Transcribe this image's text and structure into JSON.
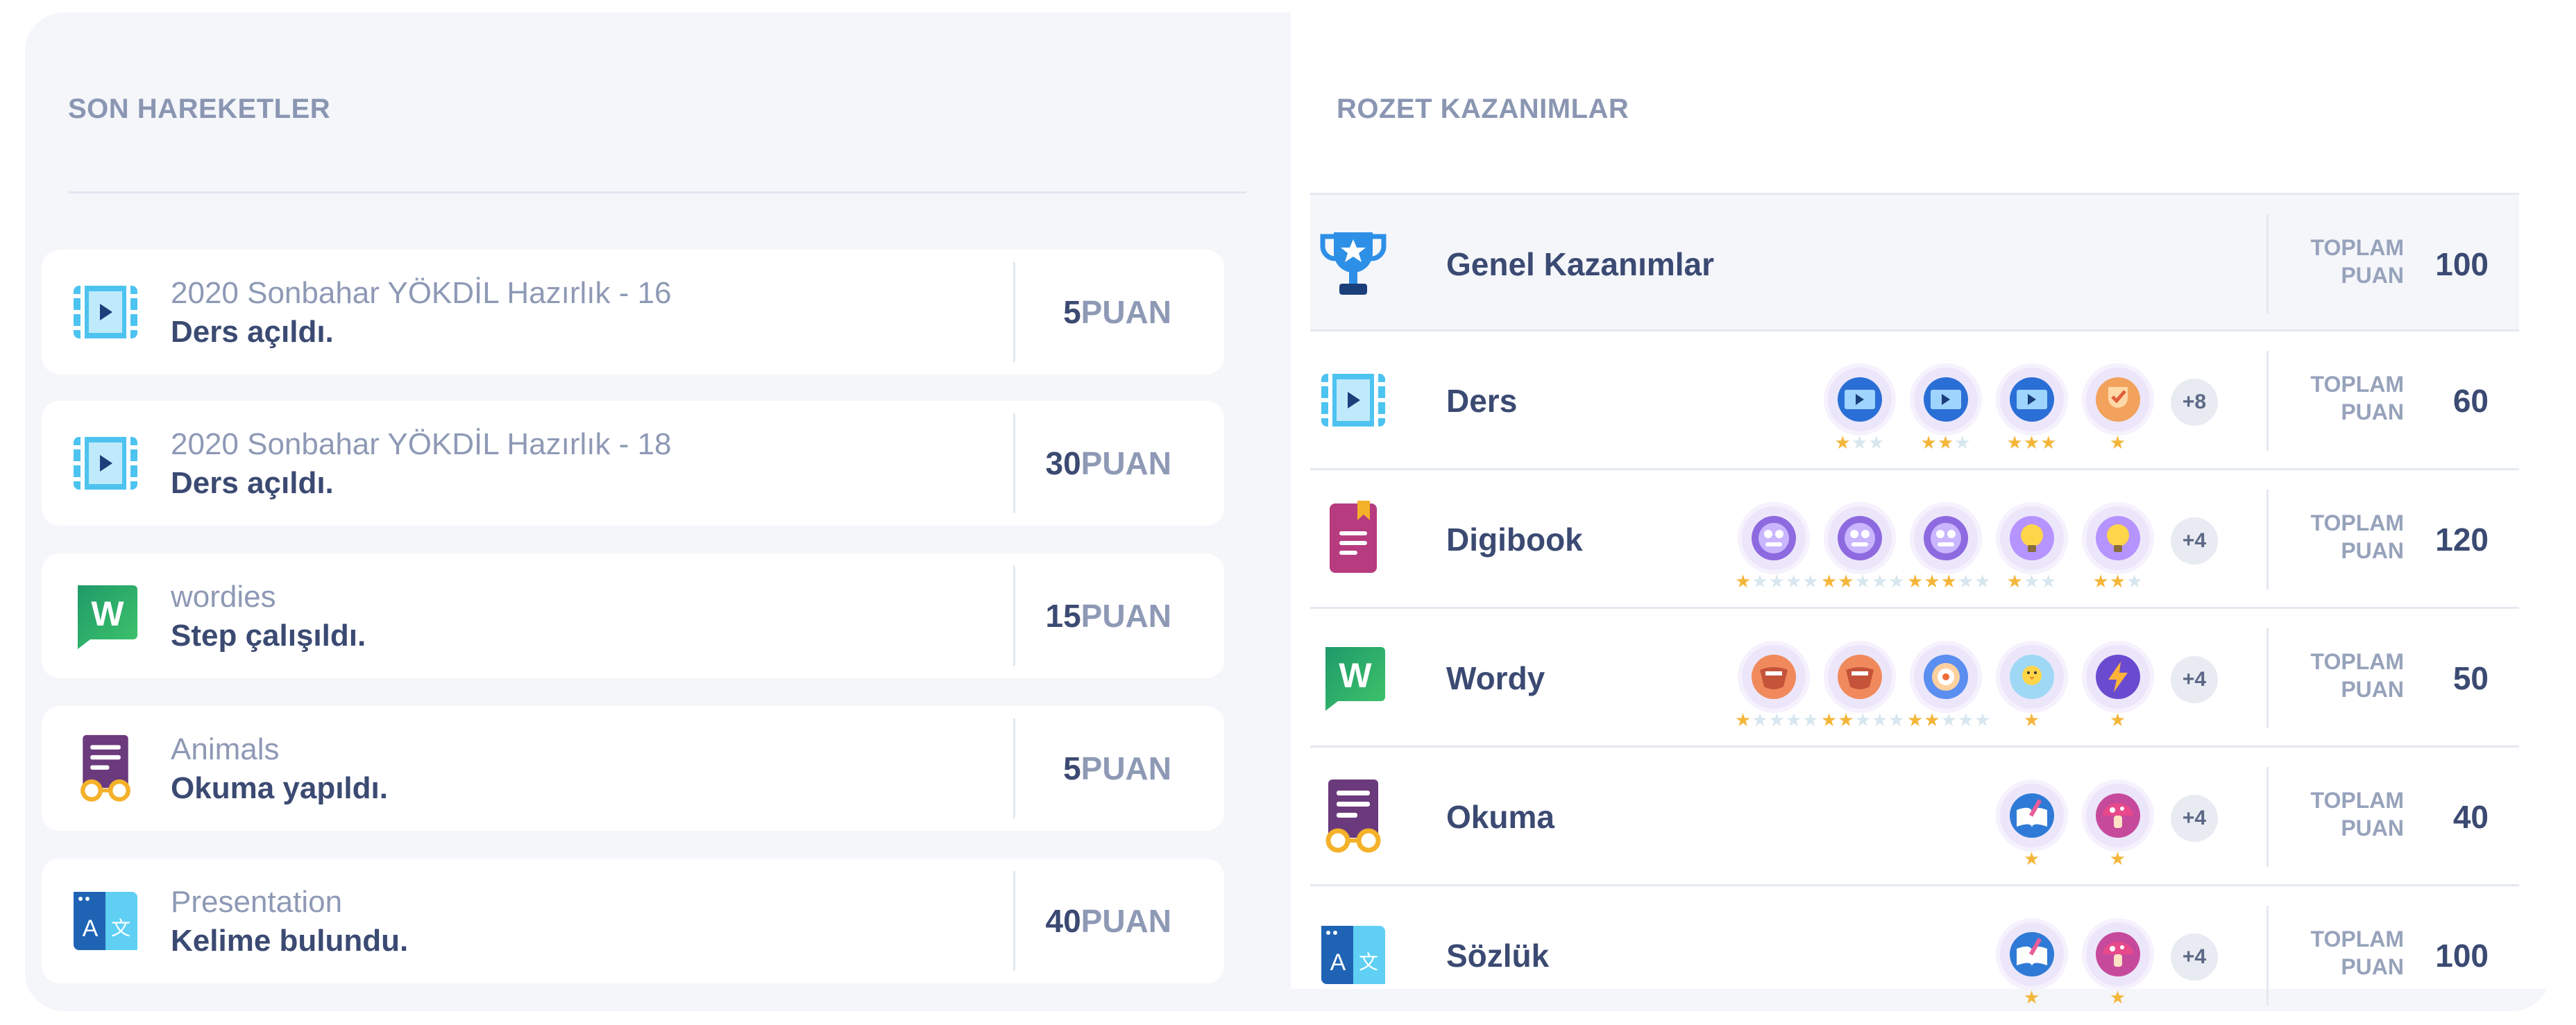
{
  "recent": {
    "title": "SON HAREKETLER",
    "items": [
      {
        "icon": "video-lesson-icon",
        "subtitle": "2020 Sonbahar YÖKDİL Hazırlık - 16",
        "text": "Ders açıldı.",
        "points": "5",
        "unit": "PUAN"
      },
      {
        "icon": "video-lesson-icon",
        "subtitle": "2020 Sonbahar YÖKDİL Hazırlık - 18",
        "text": "Ders açıldı.",
        "points": "30",
        "unit": "PUAN"
      },
      {
        "icon": "wordies-icon",
        "subtitle": "wordies",
        "text": "Step çalışıldı.",
        "points": "15",
        "unit": "PUAN"
      },
      {
        "icon": "reading-icon",
        "subtitle": "Animals",
        "text": "Okuma yapıldı.",
        "points": "5",
        "unit": "PUAN"
      },
      {
        "icon": "dictionary-icon",
        "subtitle": "Presentation",
        "text": "Kelime bulundu.",
        "points": "40",
        "unit": "PUAN"
      }
    ]
  },
  "badges": {
    "title": "ROZET KAZANIMLAR",
    "total_label_1": "TOPLAM",
    "total_label_2": "PUAN",
    "rows": [
      {
        "icon": "trophy-icon",
        "label": "Genel Kazanımlar",
        "total": "100",
        "items": [],
        "more": ""
      },
      {
        "icon": "video-lesson-icon",
        "label": "Ders",
        "total": "60",
        "more": "+8",
        "items": [
          {
            "icon": "video-badge-icon",
            "stars": 1,
            "max": 3
          },
          {
            "icon": "video-badge-icon",
            "stars": 2,
            "max": 3
          },
          {
            "icon": "video-badge-icon",
            "stars": 3,
            "max": 3
          },
          {
            "icon": "trophy-check-badge-icon",
            "stars": 1,
            "max": 1
          }
        ]
      },
      {
        "icon": "digibook-icon",
        "label": "Digibook",
        "total": "120",
        "more": "+4",
        "items": [
          {
            "icon": "book-face-badge-icon",
            "stars": 1,
            "max": 5
          },
          {
            "icon": "book-face-badge-icon",
            "stars": 2,
            "max": 5
          },
          {
            "icon": "book-face-badge-icon",
            "stars": 3,
            "max": 5
          },
          {
            "icon": "lightbulb-badge-icon",
            "stars": 1,
            "max": 3
          },
          {
            "icon": "lightbulb-badge-icon",
            "stars": 2,
            "max": 3
          }
        ]
      },
      {
        "icon": "wordies-icon",
        "label": "Wordy",
        "total": "50",
        "more": "+4",
        "items": [
          {
            "icon": "mouth-badge-icon",
            "stars": 1,
            "max": 5
          },
          {
            "icon": "mouth-badge-icon",
            "stars": 2,
            "max": 5
          },
          {
            "icon": "target-badge-icon",
            "stars": 2,
            "max": 5
          },
          {
            "icon": "chick-badge-icon",
            "stars": 1,
            "max": 1
          },
          {
            "icon": "lightning-badge-icon",
            "stars": 1,
            "max": 1
          }
        ]
      },
      {
        "icon": "reading-icon",
        "label": "Okuma",
        "total": "40",
        "more": "+4",
        "items": [
          {
            "icon": "open-book-badge-icon",
            "stars": 1,
            "max": 1
          },
          {
            "icon": "mushroom-badge-icon",
            "stars": 1,
            "max": 1
          }
        ]
      },
      {
        "icon": "dictionary-icon",
        "label": "Sözlük",
        "total": "100",
        "more": "+4",
        "items": [
          {
            "icon": "open-book-badge-icon",
            "stars": 1,
            "max": 1
          },
          {
            "icon": "mushroom-badge-icon",
            "stars": 1,
            "max": 1
          }
        ]
      }
    ]
  },
  "colors": {
    "text_dark": "#3b4a72",
    "text_muted": "#8e99b5",
    "video_blue": "#4dc3f0",
    "wordies_green": "#1f9a6a",
    "reading_purple": "#6b3a7c",
    "digibook_pink": "#b63b7f",
    "dictionary_blue": "#1f64b4",
    "star_gold": "#f4b63a"
  }
}
